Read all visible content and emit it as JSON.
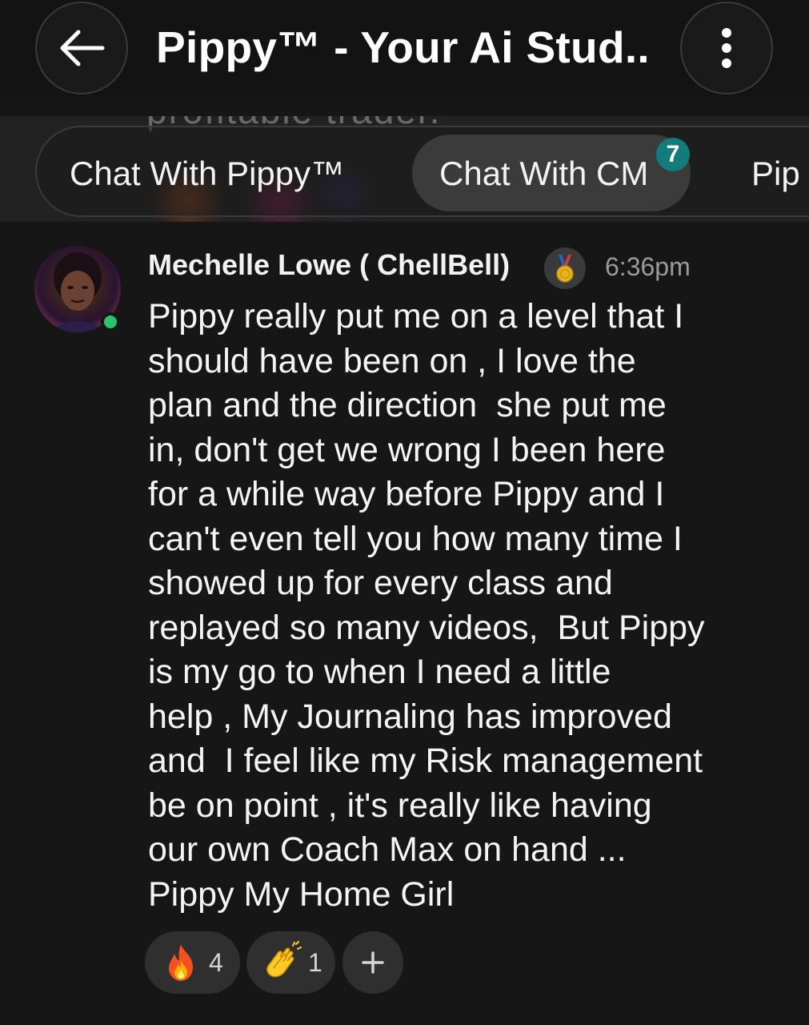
{
  "header": {
    "back_icon": "arrow-left-icon",
    "title": "Pippy™ - Your Ai Stud...",
    "menu_icon": "more-vertical-icon"
  },
  "background_text": "profitable trader.",
  "tabs": [
    {
      "label": "Chat With Pippy™",
      "active": false
    },
    {
      "label": "Chat With CM",
      "active": true,
      "badge": "7"
    },
    {
      "label": "Pip",
      "active": false
    }
  ],
  "message": {
    "author": "Mechelle Lowe ( ChellBell)",
    "author_badge_icon": "medal-icon",
    "timestamp": "6:36pm",
    "online": true,
    "lines": [
      "Pippy really put me on a level that I",
      "should have been on , I love the",
      "plan and the direction  she put me",
      "in, don't get we wrong I been here",
      "for a while way before Pippy and I",
      "can't even tell you how many time I",
      "showed up for every class and",
      "replayed so many videos,  But Pippy",
      "is my go to when I need a little",
      "help , My Journaling has improved",
      "and  I feel like my Risk management",
      "be on point , it's really like having",
      "our own Coach Max on hand ...",
      "Pippy My Home Girl"
    ]
  },
  "reactions": [
    {
      "icon": "fire-icon",
      "count": "4"
    },
    {
      "icon": "clapping-hands-icon",
      "count": "1"
    },
    {
      "icon": "add-reaction-icon",
      "label": "+"
    }
  ],
  "colors": {
    "background": "#161616",
    "tab_active": "#3b3b3b",
    "badge": "#137b7b",
    "online": "#2ec36b",
    "reaction_bg": "#2f2f2f"
  }
}
